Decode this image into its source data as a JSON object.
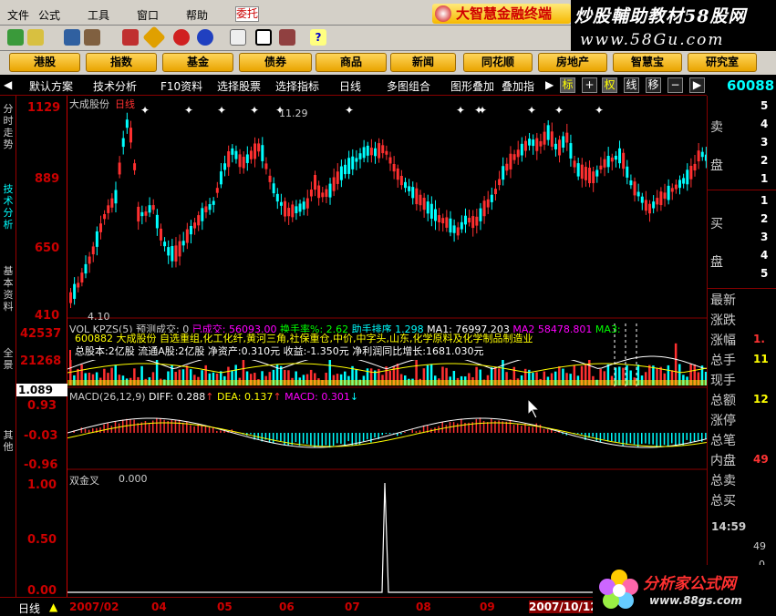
{
  "menu": {
    "items": [
      "文件",
      "公式",
      "工具",
      "窗口",
      "帮助"
    ],
    "select_value": "委托",
    "brand": "大智慧金融终端"
  },
  "watermark": {
    "line1": "炒股輔助教材58股网",
    "line2": "www.58Gu.com"
  },
  "navbar": [
    "港股",
    "指数",
    "基金",
    "债券",
    "商品",
    "新闻",
    "同花顺",
    "房地产",
    "智慧宝",
    "研究室"
  ],
  "tabs": {
    "items": [
      "默认方案",
      "技术分析",
      "F10资料",
      "选择股票",
      "选择指标",
      "日线",
      "多图组合",
      "图形叠加",
      "叠加指"
    ],
    "squares": [
      "标",
      "权",
      "线",
      "移"
    ],
    "code": "60088"
  },
  "lefttabs": [
    "分时走势",
    "技术分析",
    "基本资料",
    "全景",
    "其他"
  ],
  "price_axis": [
    "1129",
    "889",
    "650",
    "410"
  ],
  "vol_axis": [
    "42537",
    "21268"
  ],
  "macd_axis": [
    "0.93",
    "-0.03",
    "-0.96"
  ],
  "signal_axis": [
    "1.00",
    "0.50",
    "0.00"
  ],
  "stock": {
    "name": "大成股份",
    "period": "日线",
    "high_label": "11.29",
    "low_label": "4.10"
  },
  "vol_header": {
    "name": "VOL KPZS(5)",
    "predict_label": "预测成交:",
    "predict_val": "0",
    "done_label": "已成交:",
    "done_val": "56093.00",
    "hand_label": "换手率%:",
    "hand_val": "2.62",
    "rank": "助手排序",
    "rank_val": "1.298",
    "ma1": "MA1:",
    "ma1_val": "76997.203",
    "ma2": "MA2",
    "ma2_val": "58478.801",
    "ma3": "MA3:"
  },
  "info": {
    "line1": "600882 大成股份 自选重组,化工化纤,黄河三角,社保重仓,中价,中字头,山东,化学原料及化学制品制造业",
    "line2": "总股本:2亿股 流通A股:2亿股 净资产:0.310元 收益:-1.350元 净利润同比增长:1681.030元"
  },
  "macd": {
    "label": "MACD(26,12,9)",
    "diff": "DIFF: 0.288",
    "dea": "DEA: 0.137",
    "macd": "MACD: 0.301"
  },
  "signal": {
    "label": "双金叉",
    "value": "0.000"
  },
  "scale_box": "1.089",
  "right": {
    "sell_label": "卖",
    "sell_label2": "盘",
    "buy_label": "买",
    "buy_label2": "盘",
    "sell_levels": [
      "5",
      "4",
      "3",
      "2",
      "1"
    ],
    "buy_levels": [
      "1",
      "2",
      "3",
      "4",
      "5"
    ],
    "fields": [
      "最新",
      "涨跌",
      "涨幅",
      "总手",
      "现手",
      "总额",
      "涨停",
      "总笔",
      "内盘",
      "总卖",
      "总买"
    ],
    "field_vals": [
      "",
      "",
      "1.",
      "11",
      "",
      "12",
      "",
      "",
      "49",
      "",
      ""
    ],
    "time": "14:59",
    "tick1": "49",
    "tick2": "0"
  },
  "xaxis": {
    "period": "日线",
    "labels": [
      "2007/02",
      "04",
      "05",
      "06",
      "07",
      "08",
      "09",
      "2007/10/12"
    ]
  },
  "site": {
    "name": "分析家公式网",
    "url": "www.88gs.com"
  },
  "colors": {
    "up": "#ff3030",
    "down": "#00ffff",
    "axis": "#cc0000",
    "yellow": "#ffff00"
  }
}
